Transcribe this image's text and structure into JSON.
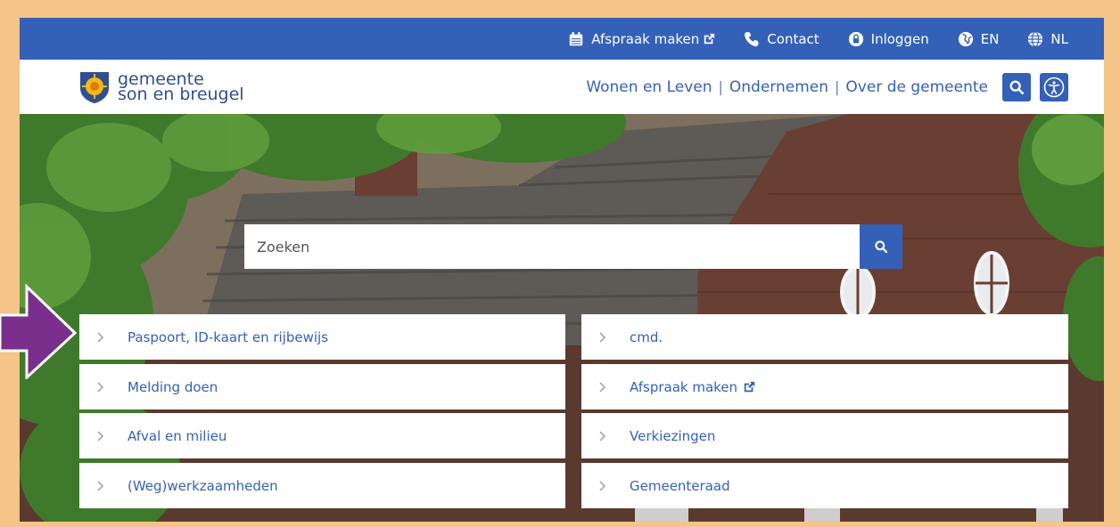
{
  "topbar": {
    "links": [
      {
        "label": "Afspraak maken",
        "external": true
      },
      {
        "label": "Contact"
      },
      {
        "label": "Inloggen"
      },
      {
        "label": "EN"
      },
      {
        "label": "NL"
      }
    ]
  },
  "header": {
    "logo_line1": "gemeente",
    "logo_line2": "son en breugel",
    "nav": [
      "Wonen en Leven",
      "Ondernemen",
      "Over de gemeente"
    ]
  },
  "search": {
    "placeholder": "Zoeken"
  },
  "tiles_left": [
    "Paspoort, ID-kaart en rijbewijs",
    "Melding doen",
    "Afval en milieu",
    "(Weg)werkzaamheden"
  ],
  "tiles_right": [
    "cmd.",
    "Afspraak maken",
    "Verkiezingen",
    "Gemeenteraad"
  ],
  "colors": {
    "brand_blue": "#3461b7",
    "frame_border": "#f4c488",
    "annotation_arrow": "#7a2f8c"
  }
}
